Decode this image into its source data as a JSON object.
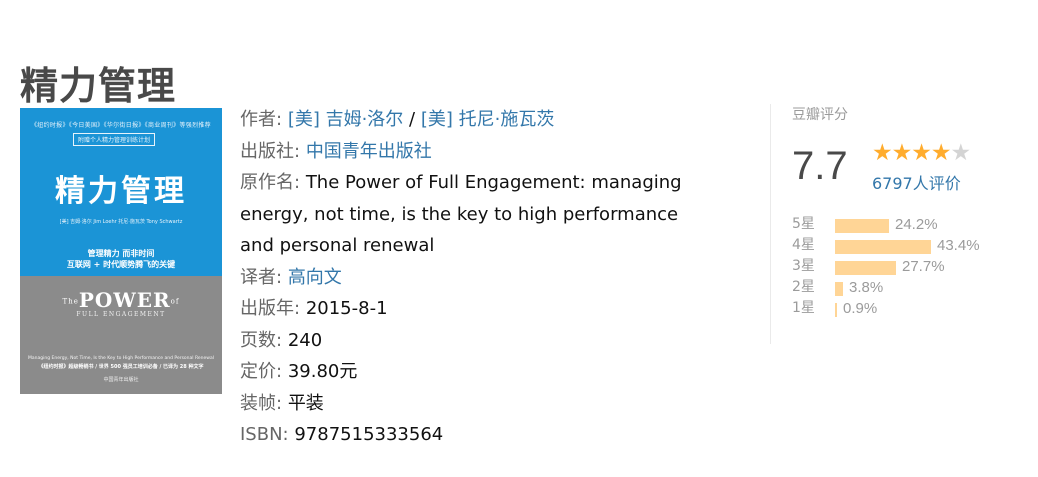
{
  "title": "精力管理",
  "cover": {
    "top_line": "《纽约时报》《今日美国》《华尔街日报》《商业周刊》等强烈推荐",
    "top_tag": "附赠个人精力管理训练计划",
    "cn_title": "精力管理",
    "authors": "[美] 吉姆·洛尔  Jim Loehr  托尼·施瓦茨  Tony Schwartz",
    "slogan_1": "管理精力  而非时间",
    "slogan_2": "互联网 + 时代顺势腾飞的关键",
    "en_the": "The",
    "en_power": "POWER",
    "en_of": "of",
    "en_sub": "FULL ENGAGEMENT",
    "blurb_1": "Managing Energy, Not Time, Is the Key to High Performance and Personal Renewal",
    "blurb_2": "《纽约时报》超级畅销书 / 世界 500 强员工培训必备 / 已译为 28 种文字",
    "logo": "中国青年出版社"
  },
  "info": {
    "author_label": "作者:",
    "author_1": "[美] 吉姆·洛尔",
    "author_sep": " / ",
    "author_2": "[美] 托尼·施瓦茨",
    "publisher_label": "出版社:",
    "publisher": "中国青年出版社",
    "original_label": "原作名:",
    "original_title": "The Power of Full Engagement: managing energy, not time, is the key to high performance and personal renewal",
    "translator_label": "译者:",
    "translator": "高向文",
    "year_label": "出版年:",
    "year": "2015-8-1",
    "pages_label": "页数:",
    "pages": "240",
    "price_label": "定价:",
    "price": "39.80元",
    "binding_label": "装帧:",
    "binding": "平装",
    "isbn_label": "ISBN:",
    "isbn": "9787515333564"
  },
  "rating": {
    "label": "豆瓣评分",
    "score": "7.7",
    "stars_filled": 4,
    "stars_total": 5,
    "star_on_color": "#ffac2d",
    "star_off_color": "#d4d4d4",
    "votes": "6797人评价",
    "bar_color": "#ffd596",
    "breakdown": [
      {
        "label": "5星",
        "percent": "24.2%",
        "value": 24.2
      },
      {
        "label": "4星",
        "percent": "43.4%",
        "value": 43.4
      },
      {
        "label": "3星",
        "percent": "27.7%",
        "value": 27.7
      },
      {
        "label": "2星",
        "percent": "3.8%",
        "value": 3.8
      },
      {
        "label": "1星",
        "percent": "0.9%",
        "value": 0.9
      }
    ]
  }
}
